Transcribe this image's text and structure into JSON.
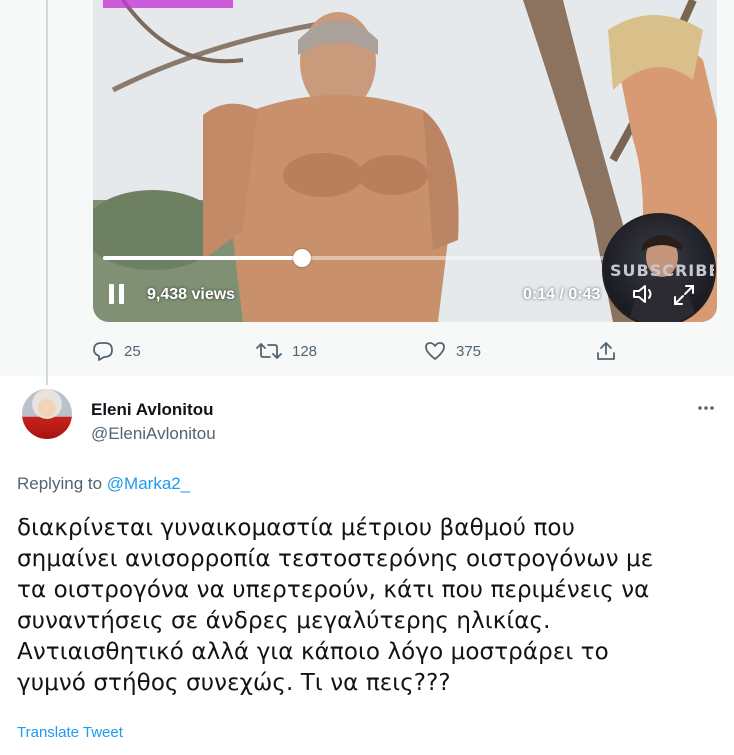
{
  "video": {
    "views": "9,438 views",
    "time": "0:14 / 0:43",
    "progress_fraction": 0.33,
    "overlay_text": "SUBSCRIBE"
  },
  "actions": {
    "reply_count": "25",
    "retweet_count": "128",
    "like_count": "375"
  },
  "reply": {
    "name": "Eleni Avlonitou",
    "handle": "@EleniAvlonitou",
    "replying_prefix": "Replying to",
    "replying_to": "@Marka2_",
    "text_lines": [
      "διακρίνεται γυναικομαστία μέτριου βαθμού που",
      "σημαίνει ανισορροπία τεστοστερόνης οιστρογόνων με",
      "τα οιστρογόνα να υπερτερούν, κάτι που περιμένεις να",
      "συναντήσεις σε άνδρες μεγαλύτερης ηλικίας.",
      "Αντιαισθητικό αλλά για κάποιο λόγο μοστράρει το",
      "γυμνό στήθος συνεχώς. Τι να πεις???"
    ],
    "translate_label": "Translate Tweet"
  },
  "colors": {
    "accent": "#1d9bf0",
    "secondary_text": "#536471",
    "primary_text": "#0f1419"
  },
  "icons": [
    "pause-icon",
    "volume-icon",
    "expand-icon",
    "reply-icon",
    "retweet-icon",
    "like-icon",
    "share-icon",
    "more-icon"
  ]
}
